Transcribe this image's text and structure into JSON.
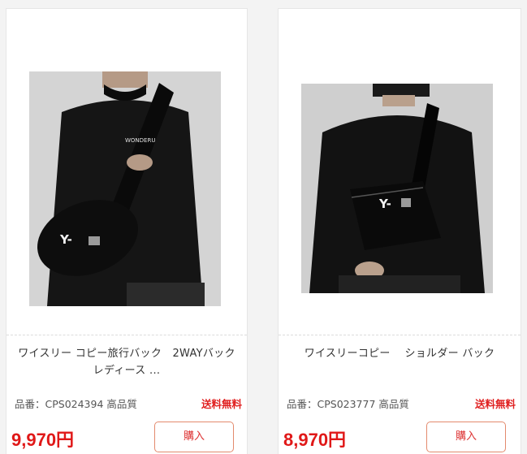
{
  "products": [
    {
      "title": "ワイスリー コピー旅行バック　2WAYバック レディース ...",
      "code": "品番：CPS024394 高品質",
      "shipping": "送料無料",
      "price": "9,970円",
      "buy_label": "購入",
      "shirt_print": "WONDERU",
      "bag_logo": "Y-"
    },
    {
      "title": "ワイスリーコピー　 ショルダー バック",
      "code": "品番：CPS023777 高品質",
      "shipping": "送料無料",
      "price": "8,970円",
      "buy_label": "購入",
      "bag_logo": "Y-"
    }
  ],
  "colors": {
    "price": "#e01818",
    "shipping": "#e02020",
    "buy_border": "#e38a6d"
  }
}
